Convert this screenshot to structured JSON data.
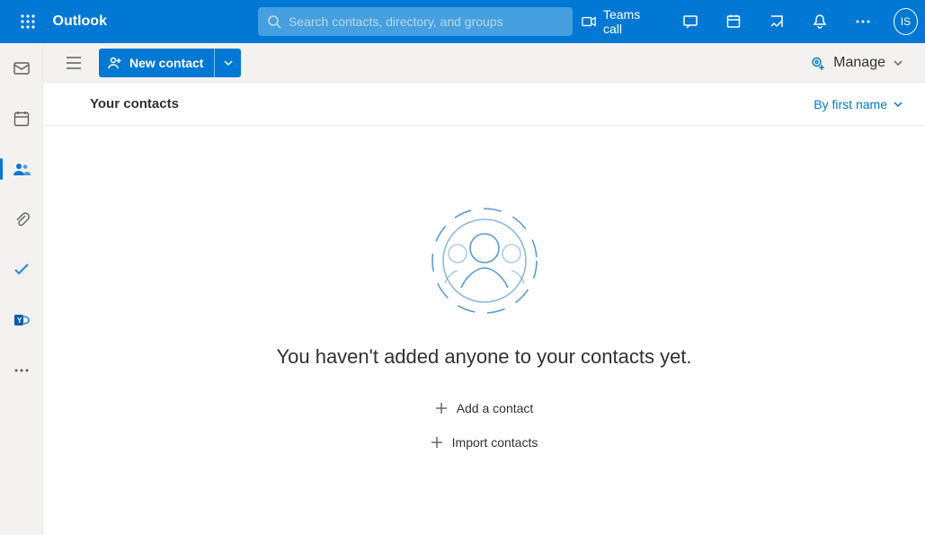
{
  "header": {
    "app_title": "Outlook",
    "search_placeholder": "Search contacts, directory, and groups",
    "teams_call_label": "Teams call",
    "avatar_initials": "IS"
  },
  "cmdbar": {
    "new_contact_label": "New contact",
    "manage_label": "Manage"
  },
  "subheader": {
    "title": "Your contacts",
    "sort_label": "By first name"
  },
  "empty": {
    "heading": "You haven't added anyone to your contacts yet.",
    "add_label": "Add a contact",
    "import_label": "Import contacts"
  }
}
